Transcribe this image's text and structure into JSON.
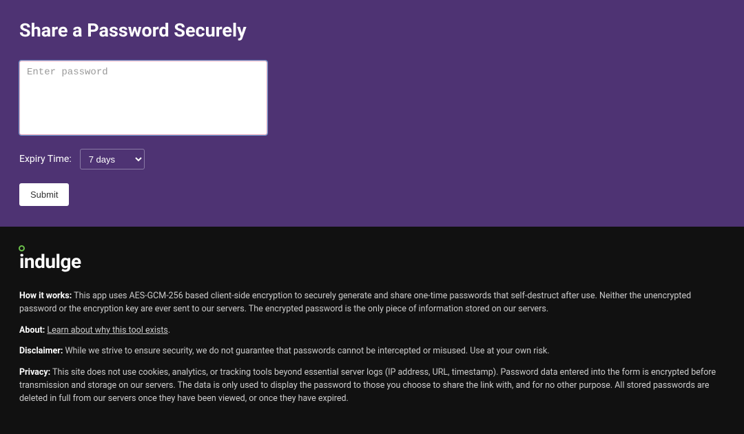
{
  "page": {
    "title": "Share a Password Securely"
  },
  "form": {
    "password_placeholder": "Enter password",
    "password_value": "",
    "expiry_label": "Expiry Time:",
    "expiry_selected": "7 days",
    "submit_label": "Submit"
  },
  "footer": {
    "logo_text": "indulge",
    "how_it_works_label": "How it works:",
    "how_it_works_text": " This app uses AES-GCM-256 based client-side encryption to securely generate and share one-time passwords that self-destruct after use. Neither the unencrypted password or the encryption key are ever sent to our servers. The encrypted password is the only piece of information stored on our servers.",
    "about_label": "About:",
    "about_link_text": "Learn about why this tool exists",
    "about_suffix": ".",
    "disclaimer_label": "Disclaimer:",
    "disclaimer_text": " While we strive to ensure security, we do not guarantee that passwords cannot be intercepted or misused. Use at your own risk.",
    "privacy_label": "Privacy:",
    "privacy_text": " This site does not use cookies, analytics, or tracking tools beyond essential server logs (IP address, URL, timestamp). Password data entered into the form is encrypted before transmission and storage on our servers. The data is only used to display the password to those you choose to share the link with, and for no other purpose. All stored passwords are deleted in full from our servers once they have been viewed, or once they have expired."
  }
}
